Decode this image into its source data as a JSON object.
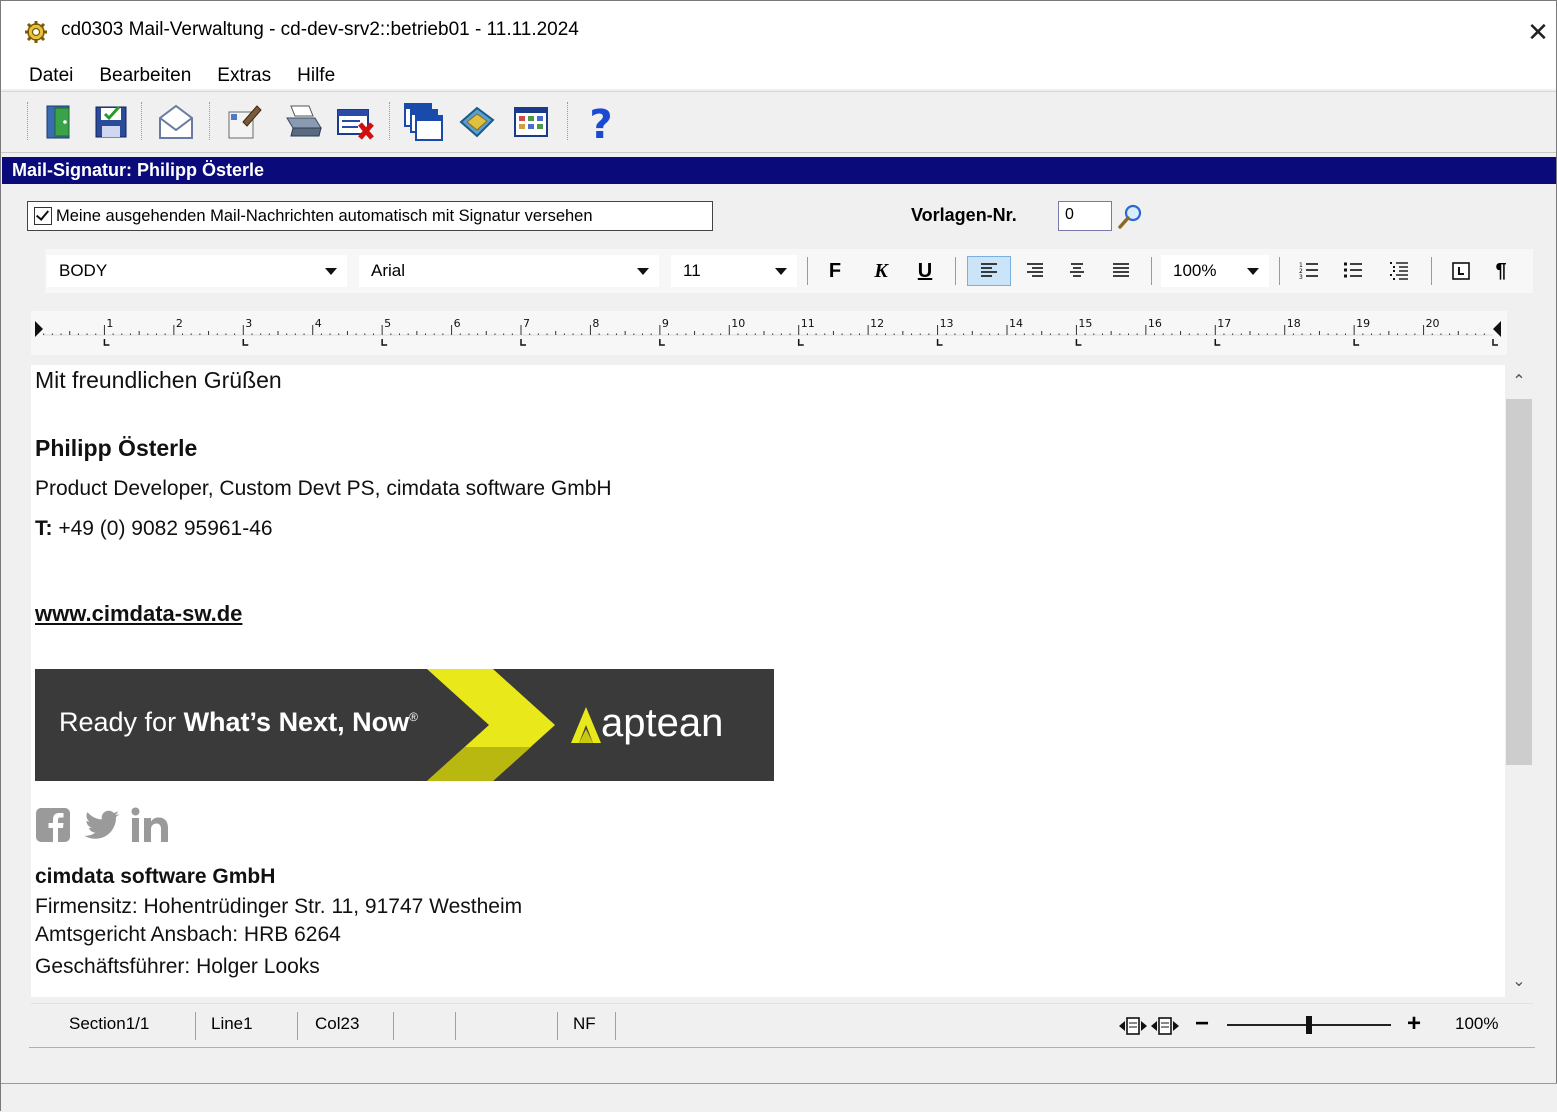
{
  "window": {
    "title": "cd0303 Mail-Verwaltung - cd-dev-srv2::betrieb01 - 11.11.2024",
    "close_label": "✕"
  },
  "menu": [
    {
      "label": "Datei"
    },
    {
      "label": "Bearbeiten"
    },
    {
      "label": "Extras"
    },
    {
      "label": "Hilfe"
    }
  ],
  "toolbar": {
    "buttons": [
      "exit-icon",
      "save-icon",
      "mail-icon",
      "edit-icon",
      "print-icon",
      "delete-icon",
      "windows-icon",
      "book-icon",
      "grid-icon",
      "help-icon"
    ]
  },
  "section": {
    "title": "Mail-Signatur: Philipp Österle"
  },
  "options": {
    "auto_signature_label": "Meine ausgehenden Mail-Nachrichten automatisch mit Signatur versehen",
    "auto_signature_checked": true,
    "template_label": "Vorlagen-Nr.",
    "template_value": "0"
  },
  "format": {
    "style": "BODY",
    "font": "Arial",
    "size": "11",
    "bold_label": "F",
    "italic_label": "K",
    "underline_label": "U",
    "zoom": "100%",
    "paragraph_mark": "¶"
  },
  "ruler": {
    "marks": [
      "1",
      "2",
      "3",
      "4",
      "5",
      "6",
      "7",
      "8",
      "9",
      "10",
      "11",
      "12",
      "13",
      "14",
      "15",
      "16",
      "17",
      "18",
      "19",
      "20"
    ]
  },
  "signature": {
    "greeting": "Mit freundlichen Grüßen",
    "name": "Philipp Österle",
    "role": "Product Developer, Custom Devt PS, cimdata software GmbH",
    "phone_label": "T:",
    "phone": " +49 (0) 9082 95961-46",
    "website": "www.cimdata-sw.de",
    "banner_text_regular": "Ready for ",
    "banner_text_bold": "What’s Next, Now",
    "banner_reg": "®",
    "banner_brand": "aptean",
    "company": "cimdata software GmbH",
    "address_line1": "Firmensitz: Hohentrüdinger Str. 11, 91747 Westheim",
    "address_line2": "Amtsgericht Ansbach: HRB 6264",
    "address_line3": "Geschäftsführer: Holger Looks"
  },
  "colors": {
    "section_header": "#0a0a7a",
    "banner_bg": "#3a3a3a",
    "banner_accent": "#e8e81a",
    "social_icons": "#9a9a9a"
  },
  "status": {
    "section": "Section1/1",
    "line": "Line1",
    "col": "Col23",
    "mode": "NF",
    "zoom": "100%",
    "zoom_level": 0.5,
    "minus": "−",
    "plus": "+"
  }
}
